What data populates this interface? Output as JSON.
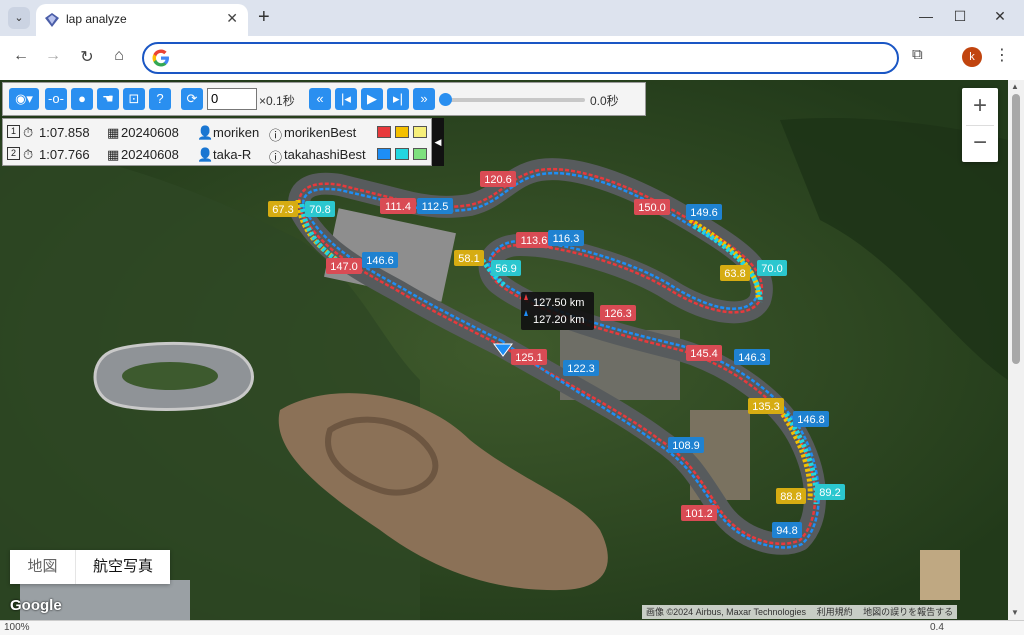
{
  "browser": {
    "tab_title": "lap analyze",
    "tab_close": "✕",
    "new_tab": "+",
    "tab_list": "⌄",
    "minimize": "—",
    "maximize": "☐",
    "close": "✕",
    "back": "←",
    "forward": "→",
    "reload": "↻",
    "home": "⌂",
    "address_value": "",
    "profile_initial": "k",
    "menu": "⋮",
    "extensions_icon": "puzzle-icon"
  },
  "controls": {
    "frame_value": "0",
    "frame_unit": "×0.1秒",
    "time": "0.0秒",
    "seek_position": 0,
    "accent": "#2a8ff0"
  },
  "laps": [
    {
      "index": "1",
      "time": "1:07.858",
      "date": "20240608",
      "driver": "moriken",
      "session": "morikenBest",
      "colors": [
        "#e8393c",
        "#f5c000",
        "#f7ef7a"
      ]
    },
    {
      "index": "2",
      "time": "1:07.766",
      "date": "20240608",
      "driver": "taka-R",
      "session": "takahashiBest",
      "colors": [
        "#1e8ef5",
        "#22d6e0",
        "#7ee07e"
      ]
    }
  ],
  "cursor_speeds": {
    "lap1": "127.50 km",
    "lap2": "127.20 km"
  },
  "speed_labels": [
    {
      "v": "120.6",
      "c": "#d94b54"
    },
    {
      "v": "111.4",
      "c": "#d94b54"
    },
    {
      "v": "112.5",
      "c": "#1f82d1"
    },
    {
      "v": "67.3",
      "c": "#d6ac12"
    },
    {
      "v": "70.8",
      "c": "#2bc7cf"
    },
    {
      "v": "147.0",
      "c": "#d94b54"
    },
    {
      "v": "146.6",
      "c": "#1f82d1"
    },
    {
      "v": "58.1",
      "c": "#d6ac12"
    },
    {
      "v": "56.9",
      "c": "#2bc7cf"
    },
    {
      "v": "113.6",
      "c": "#d94b54"
    },
    {
      "v": "116.3",
      "c": "#1f82d1"
    },
    {
      "v": "150.0",
      "c": "#d94b54"
    },
    {
      "v": "149.6",
      "c": "#1f82d1"
    },
    {
      "v": "63.8",
      "c": "#d6ac12"
    },
    {
      "v": "70.0",
      "c": "#2bc7cf"
    },
    {
      "v": "126.3",
      "c": "#d94b54"
    },
    {
      "v": "125.1",
      "c": "#d94b54"
    },
    {
      "v": "122.3",
      "c": "#1f82d1"
    },
    {
      "v": "145.4",
      "c": "#d94b54"
    },
    {
      "v": "146.3",
      "c": "#1f82d1"
    },
    {
      "v": "135.3",
      "c": "#d6ac12"
    },
    {
      "v": "146.8",
      "c": "#1f82d1"
    },
    {
      "v": "108.9",
      "c": "#1f82d1"
    },
    {
      "v": "88.8",
      "c": "#d6ac12"
    },
    {
      "v": "89.2",
      "c": "#2bc7cf"
    },
    {
      "v": "101.2",
      "c": "#d94b54"
    },
    {
      "v": "94.8",
      "c": "#1f82d1"
    }
  ],
  "zoom": {
    "in": "+",
    "out": "−"
  },
  "map_type": {
    "map": "地図",
    "satellite": "航空写真",
    "selected": "satellite"
  },
  "google_logo": "Google",
  "attribution": {
    "imagery": "画像 ©2024 Airbus, Maxar Technologies",
    "terms": "利用規約",
    "report": "地図の誤りを報告する"
  },
  "status": {
    "left": "100%",
    "right": "0.4"
  }
}
